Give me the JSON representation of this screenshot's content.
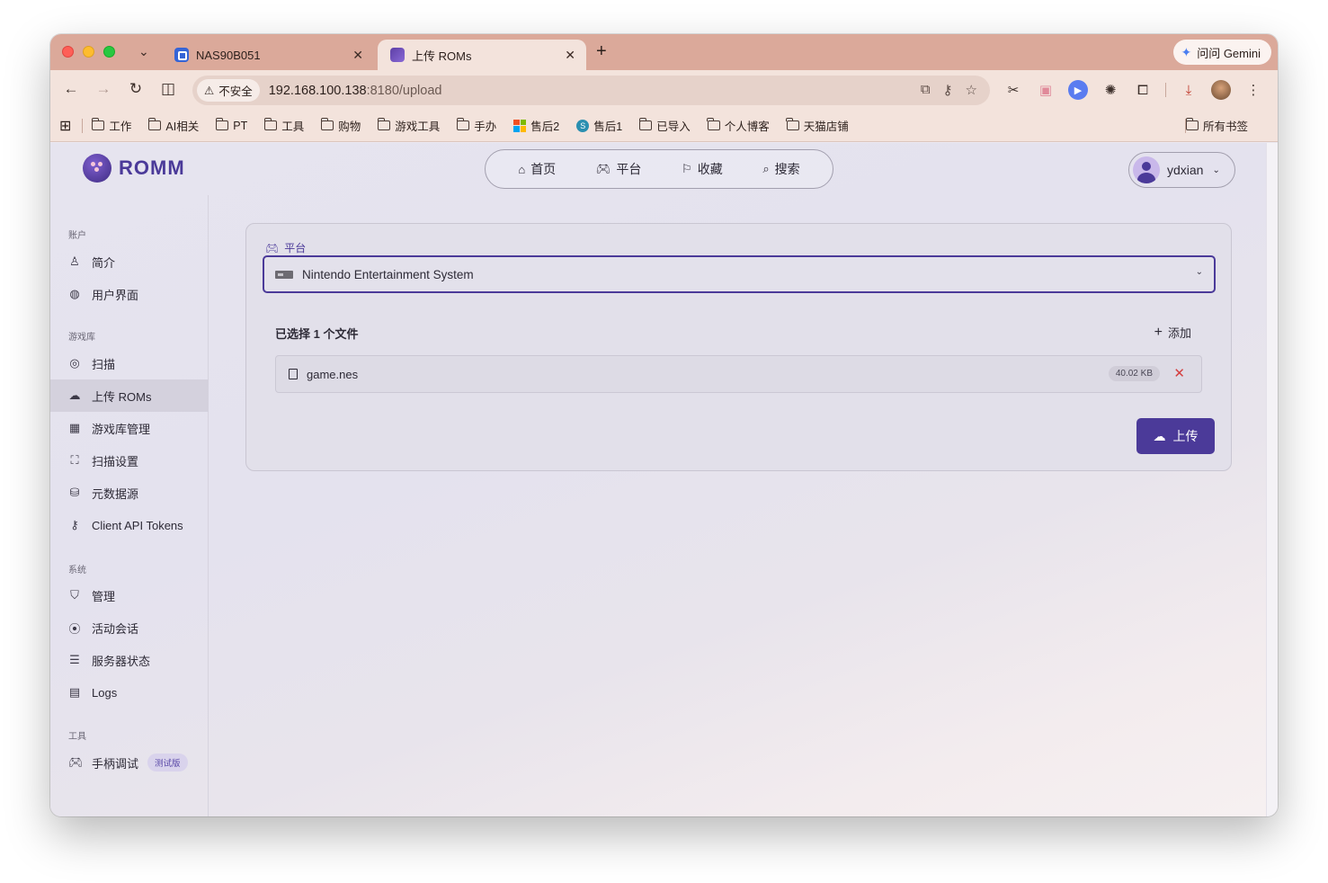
{
  "browser": {
    "tabs": [
      {
        "title": "NAS90B051",
        "close": "✕"
      },
      {
        "title": "上传 ROMs",
        "close": "✕"
      }
    ],
    "new_tab": "+",
    "gemini_label": "问问 Gemini",
    "insecure_label": "不安全",
    "url_host": "192.168.100.138",
    "url_path": ":8180/upload",
    "bookmarks": [
      "工作",
      "AI相关",
      "PT",
      "工具",
      "购物",
      "游戏工具",
      "手办",
      "售后2",
      "售后1",
      "已导入",
      "个人博客",
      "天猫店铺"
    ],
    "all_bookmarks": "所有书签"
  },
  "app": {
    "logo_text": "ROMM",
    "nav": [
      {
        "label": "首页",
        "icon": "home-icon"
      },
      {
        "label": "平台",
        "icon": "gamepad-icon"
      },
      {
        "label": "收藏",
        "icon": "bookmark-icon"
      },
      {
        "label": "搜索",
        "icon": "search-icon"
      }
    ],
    "user": {
      "name": "ydxian"
    }
  },
  "sidebar": {
    "sections": [
      {
        "title": "账户",
        "items": [
          {
            "label": "简介",
            "icon": "person-icon"
          },
          {
            "label": "用户界面",
            "icon": "palette-icon"
          }
        ]
      },
      {
        "title": "游戏库",
        "items": [
          {
            "label": "扫描",
            "icon": "radar-icon"
          },
          {
            "label": "上传 ROMs",
            "icon": "cloud-upload-icon",
            "active": true
          },
          {
            "label": "游戏库管理",
            "icon": "table-cog-icon"
          },
          {
            "label": "扫描设置",
            "icon": "scan-settings-icon"
          },
          {
            "label": "元数据源",
            "icon": "database-cog-icon"
          },
          {
            "label": "Client API Tokens",
            "icon": "key-icon"
          }
        ]
      },
      {
        "title": "系统",
        "items": [
          {
            "label": "管理",
            "icon": "shield-icon"
          },
          {
            "label": "活动会话",
            "icon": "broadcast-icon"
          },
          {
            "label": "服务器状态",
            "icon": "server-icon"
          },
          {
            "label": "Logs",
            "icon": "logs-icon"
          }
        ]
      },
      {
        "title": "工具",
        "items": [
          {
            "label": "手柄调试",
            "icon": "gamepad-icon",
            "badge": "测试版"
          }
        ]
      }
    ]
  },
  "upload": {
    "platform_label": "平台",
    "platform_value": "Nintendo Entertainment System",
    "files_selected": "已选择 1 个文件",
    "add_label": "添加",
    "files": [
      {
        "name": "game.nes",
        "size": "40.02 KB"
      }
    ],
    "upload_label": "上传"
  }
}
